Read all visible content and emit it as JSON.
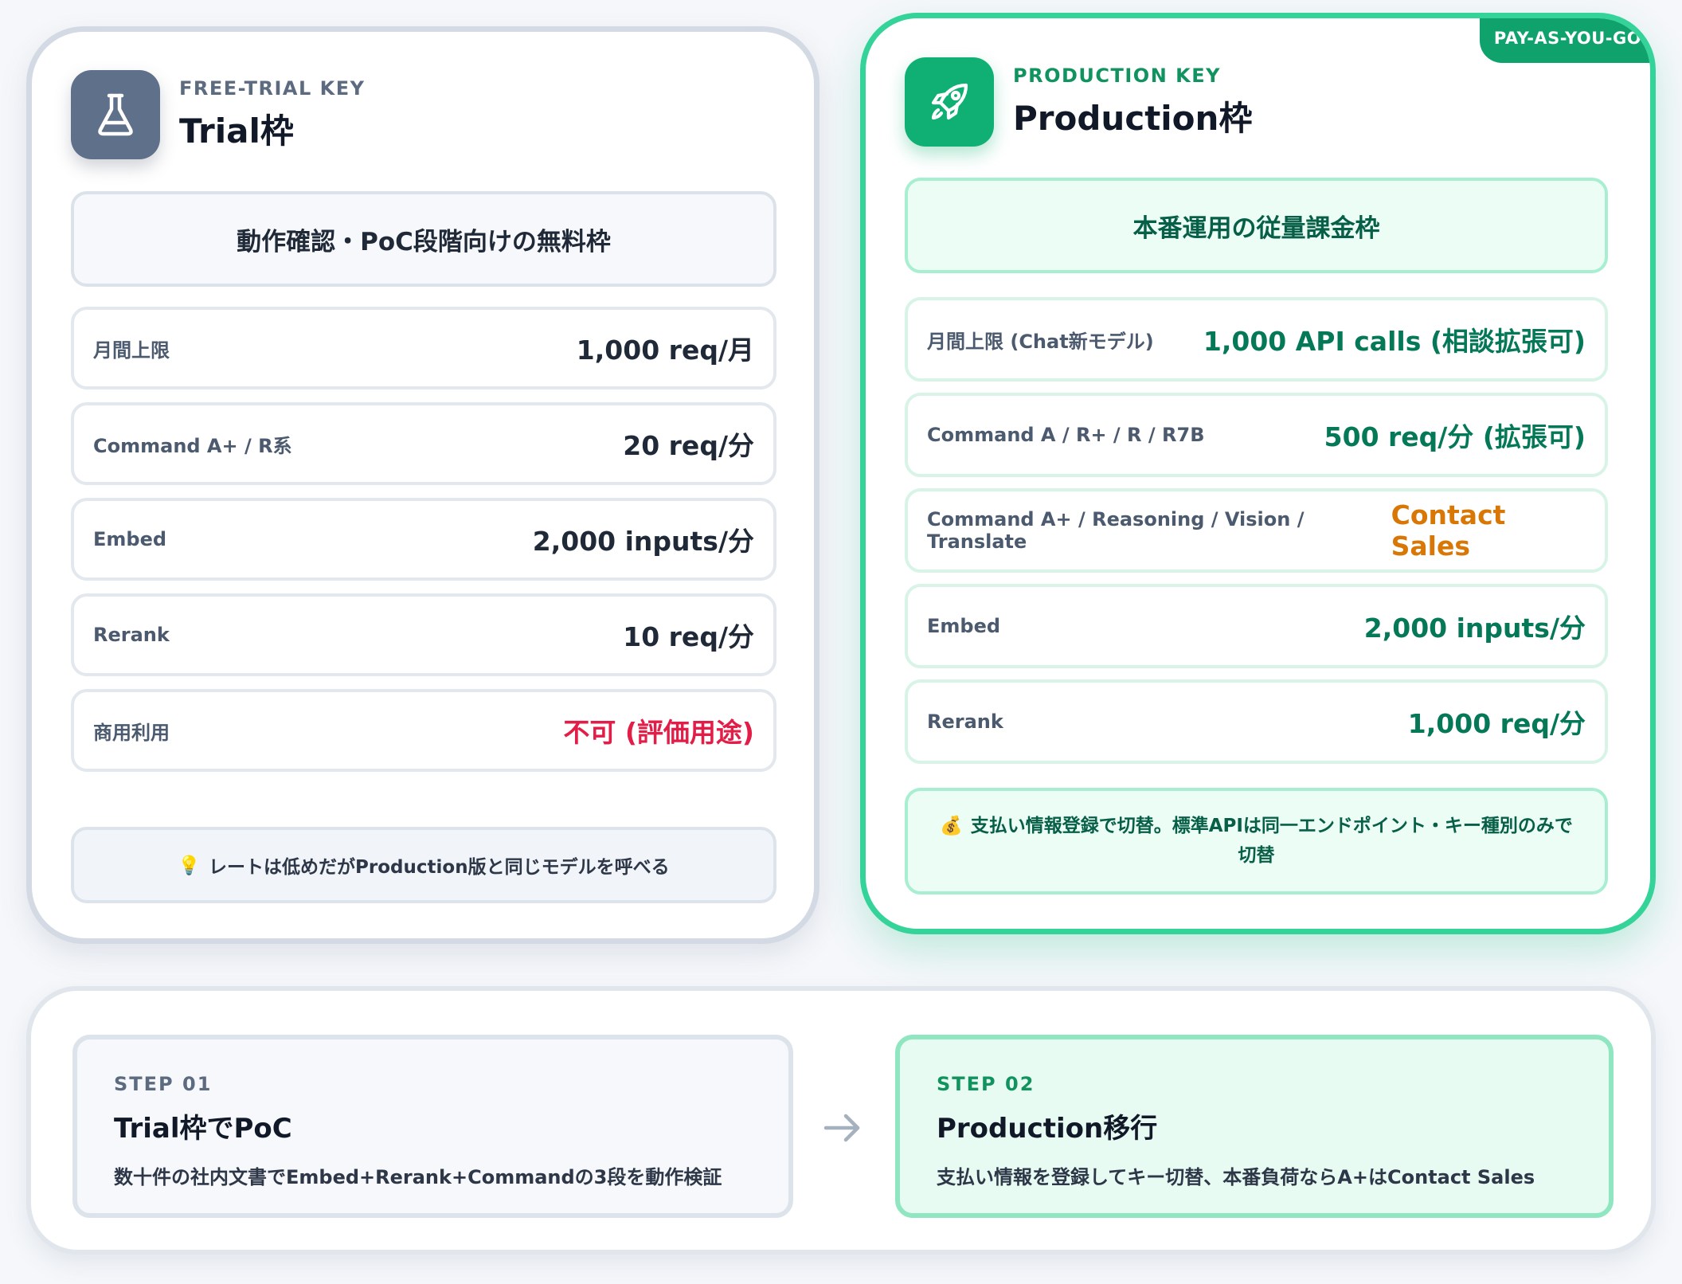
{
  "trial": {
    "kicker": "FREE-TRIAL KEY",
    "title": "Trial枠",
    "icon": "flask-icon",
    "summary": "動作確認・PoC段階向けの無料枠",
    "rows": [
      {
        "label": "月間上限",
        "value": "1,000 req/月"
      },
      {
        "label": "Command A+ / R系",
        "value": "20 req/分"
      },
      {
        "label": "Embed",
        "value": "2,000 inputs/分"
      },
      {
        "label": "Rerank",
        "value": "10 req/分"
      },
      {
        "label": "商用利用",
        "value": "不可 (評価用途)"
      }
    ],
    "note_emoji": "💡",
    "note": "レートは低めだがProduction版と同じモデルを呼べる"
  },
  "production": {
    "badge": "PAY-AS-YOU-GO",
    "kicker": "PRODUCTION KEY",
    "title": "Production枠",
    "icon": "rocket-icon",
    "summary": "本番運用の従量課金枠",
    "rows": [
      {
        "label": "月間上限 (Chat新モデル)",
        "value": "1,000 API calls (相談拡張可)"
      },
      {
        "label": "Command A / R+ / R / R7B",
        "value": "500 req/分 (拡張可)"
      },
      {
        "label": "Command A+ / Reasoning / Vision / Translate",
        "value": "Contact Sales"
      },
      {
        "label": "Embed",
        "value": "2,000 inputs/分"
      },
      {
        "label": "Rerank",
        "value": "1,000 req/分"
      }
    ],
    "note_emoji": "💰",
    "note_line1": "支払い情報登録で切替。標準APIは同一エンドポイント・キー種別のみで",
    "note_line2": "切替"
  },
  "steps": [
    {
      "kicker": "STEP 01",
      "title": "Trial枠でPoC",
      "desc": "数十件の社内文書でEmbed+Rerank+Commandの3段を動作検証"
    },
    {
      "kicker": "STEP 02",
      "title": "Production移行",
      "desc": "支払い情報を登録してキー切替、本番負荷ならA+はContact Sales"
    }
  ],
  "colors": {
    "trial_accent": "#5f708a",
    "production_accent": "#10b074",
    "warning_red": "#e11d48",
    "value_green": "#047857",
    "contact_orange": "#d97706"
  }
}
